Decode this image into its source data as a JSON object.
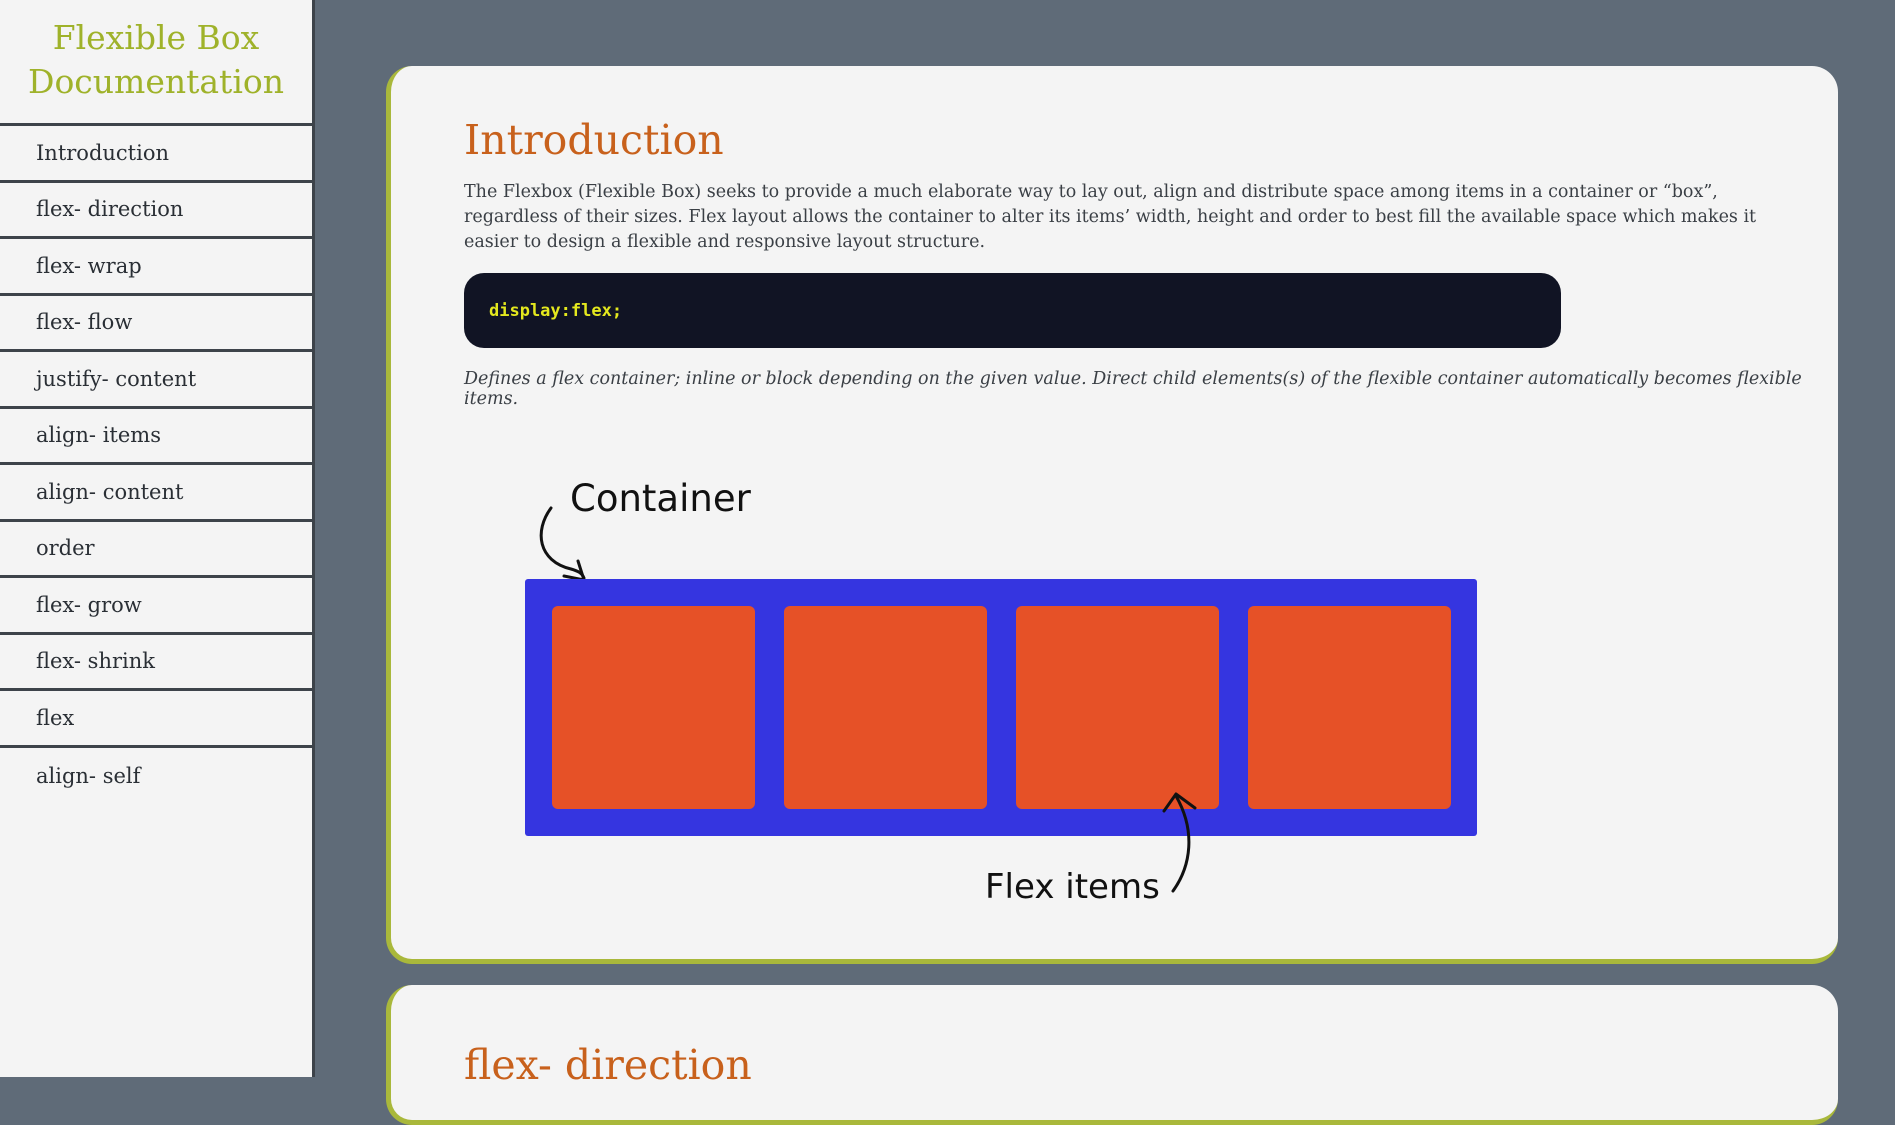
{
  "sidebar": {
    "title_line1": "Flexible Box",
    "title_line2": "Documentation",
    "items": [
      {
        "label": "Introduction"
      },
      {
        "label": "flex- direction"
      },
      {
        "label": "flex- wrap"
      },
      {
        "label": "flex- flow"
      },
      {
        "label": "justify- content"
      },
      {
        "label": "align- items"
      },
      {
        "label": "align- content"
      },
      {
        "label": "order"
      },
      {
        "label": "flex- grow"
      },
      {
        "label": "flex- shrink"
      },
      {
        "label": "flex"
      },
      {
        "label": "align- self"
      }
    ]
  },
  "sections": {
    "intro": {
      "title": "Introduction",
      "paragraph": "The Flexbox (Flexible Box) seeks to provide a much elaborate way to lay out, align and distribute space among items in a container or “box”, regardless of their sizes. Flex layout allows the container to alter its items’ width, height and order to best fill the available space which makes it easier to design a flexible and responsive layout structure.",
      "code": "display:flex;",
      "caption": "Defines a flex container; inline or block depending on the given value. Direct child elements(s) of the flexible container automatically becomes flexible items.",
      "diagram": {
        "container_label": "Container",
        "items_label": "Flex items",
        "item_count": 4,
        "container_color": "#3535e0",
        "item_color": "#e65127"
      }
    },
    "next": {
      "title": "flex- direction"
    }
  },
  "colors": {
    "background": "#5f6b78",
    "title_green": "#9fb22a",
    "heading_orange": "#c8611c",
    "code_bg": "#111424",
    "code_text": "#e4e81e",
    "card_accent": "#a9b83b"
  }
}
